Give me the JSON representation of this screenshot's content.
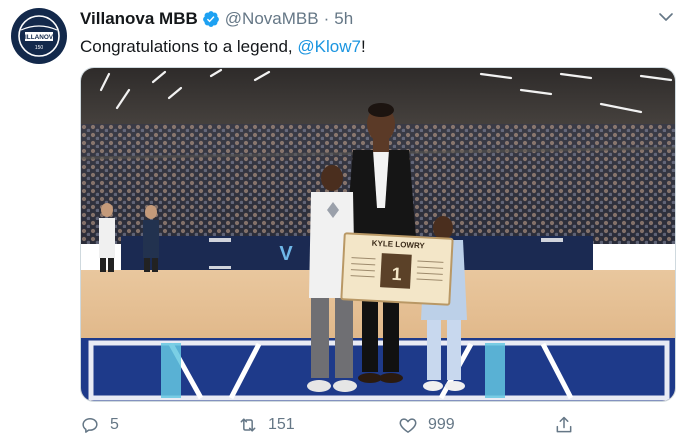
{
  "tweet": {
    "display_name": "Villanova MBB",
    "handle": "@NovaMBB",
    "separator": "·",
    "time": "5h",
    "text_before": "Congratulations to a legend, ",
    "mention": "@Klow7",
    "text_after": "!",
    "avatar_text": "VILLANOVA",
    "avatar_subtext": "150"
  },
  "media": {
    "plaque_title": "KYLE LOWRY",
    "plaque_number": "1"
  },
  "actions": {
    "replies": "5",
    "retweets": "151",
    "likes": "999"
  },
  "colors": {
    "link": "#1b95e0",
    "muted": "#657786",
    "verified": "#1da1f2",
    "avatar_bg": "#13294b"
  }
}
